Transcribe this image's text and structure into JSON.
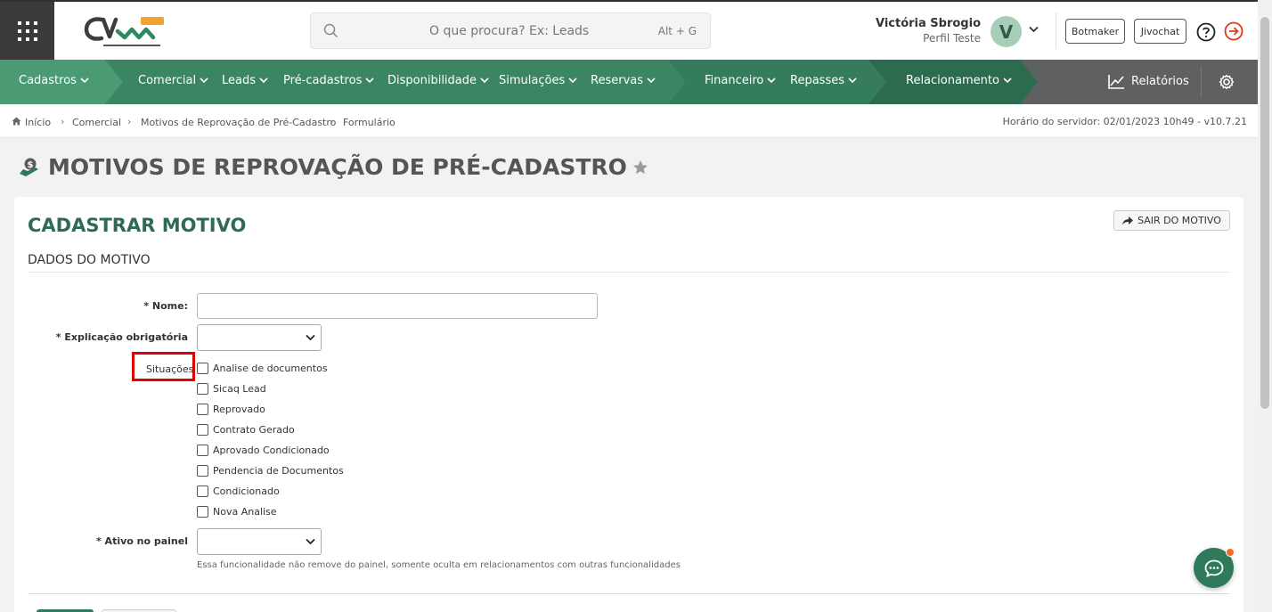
{
  "header": {
    "search_placeholder": "O que procura? Ex: Leads",
    "search_shortcut": "Alt + G",
    "user_name": "Victória Sbrogio",
    "user_profile": "Perfil Teste",
    "avatar_letter": "V",
    "botmaker_label": "Botmaker",
    "jivochat_label": "Jivochat"
  },
  "nav": {
    "items": [
      {
        "label": "Cadastros"
      },
      {
        "label": "Comercial"
      },
      {
        "label": "Leads"
      },
      {
        "label": "Pré-cadastros"
      },
      {
        "label": "Disponibilidade"
      },
      {
        "label": "Simulações"
      },
      {
        "label": "Reservas"
      },
      {
        "label": "Financeiro"
      },
      {
        "label": "Repasses"
      },
      {
        "label": "Relacionamento"
      }
    ],
    "reports_label": "Relatórios"
  },
  "breadcrumb": {
    "items": [
      "Início",
      "Comercial",
      "Motivos de Reprovação de Pré-Cadastro",
      "Formulário"
    ],
    "server_time": "Horário do servidor: 02/01/2023 10h49 - v10.7.21"
  },
  "page": {
    "title": "MOTIVOS DE REPROVAÇÃO DE PRÉ-CADASTRO"
  },
  "form": {
    "title": "CADASTRAR MOTIVO",
    "exit_label": "SAIR DO MOTIVO",
    "section_title": "DADOS DO MOTIVO",
    "name_label": "* Nome:",
    "name_value": "",
    "explanation_label": "* Explicação obrigatória",
    "explanation_value": "",
    "situations_label": "Situações",
    "situations": [
      {
        "label": "Analise de documentos",
        "checked": false
      },
      {
        "label": "Sicaq Lead",
        "checked": false
      },
      {
        "label": "Reprovado",
        "checked": false
      },
      {
        "label": "Contrato Gerado",
        "checked": false
      },
      {
        "label": "Aprovado Condicionado",
        "checked": false
      },
      {
        "label": "Pendencia de Documentos",
        "checked": false
      },
      {
        "label": "Condicionado",
        "checked": false
      },
      {
        "label": "Nova Analise",
        "checked": false
      }
    ],
    "active_label": "* Ativo no painel",
    "active_value": "",
    "active_hint": "Essa funcionalidade não remove do painel, somente oculta em relacionamentos com outras funcionalidades"
  },
  "colors": {
    "nav_green_light": "#4a9a74",
    "nav_green": "#3b8563",
    "nav_green_dark": "#2d6b4f",
    "nav_gray": "#5f6062",
    "title_green": "#2e6a56",
    "highlight_red": "#e00000",
    "chat_dot": "#f26b2a"
  }
}
